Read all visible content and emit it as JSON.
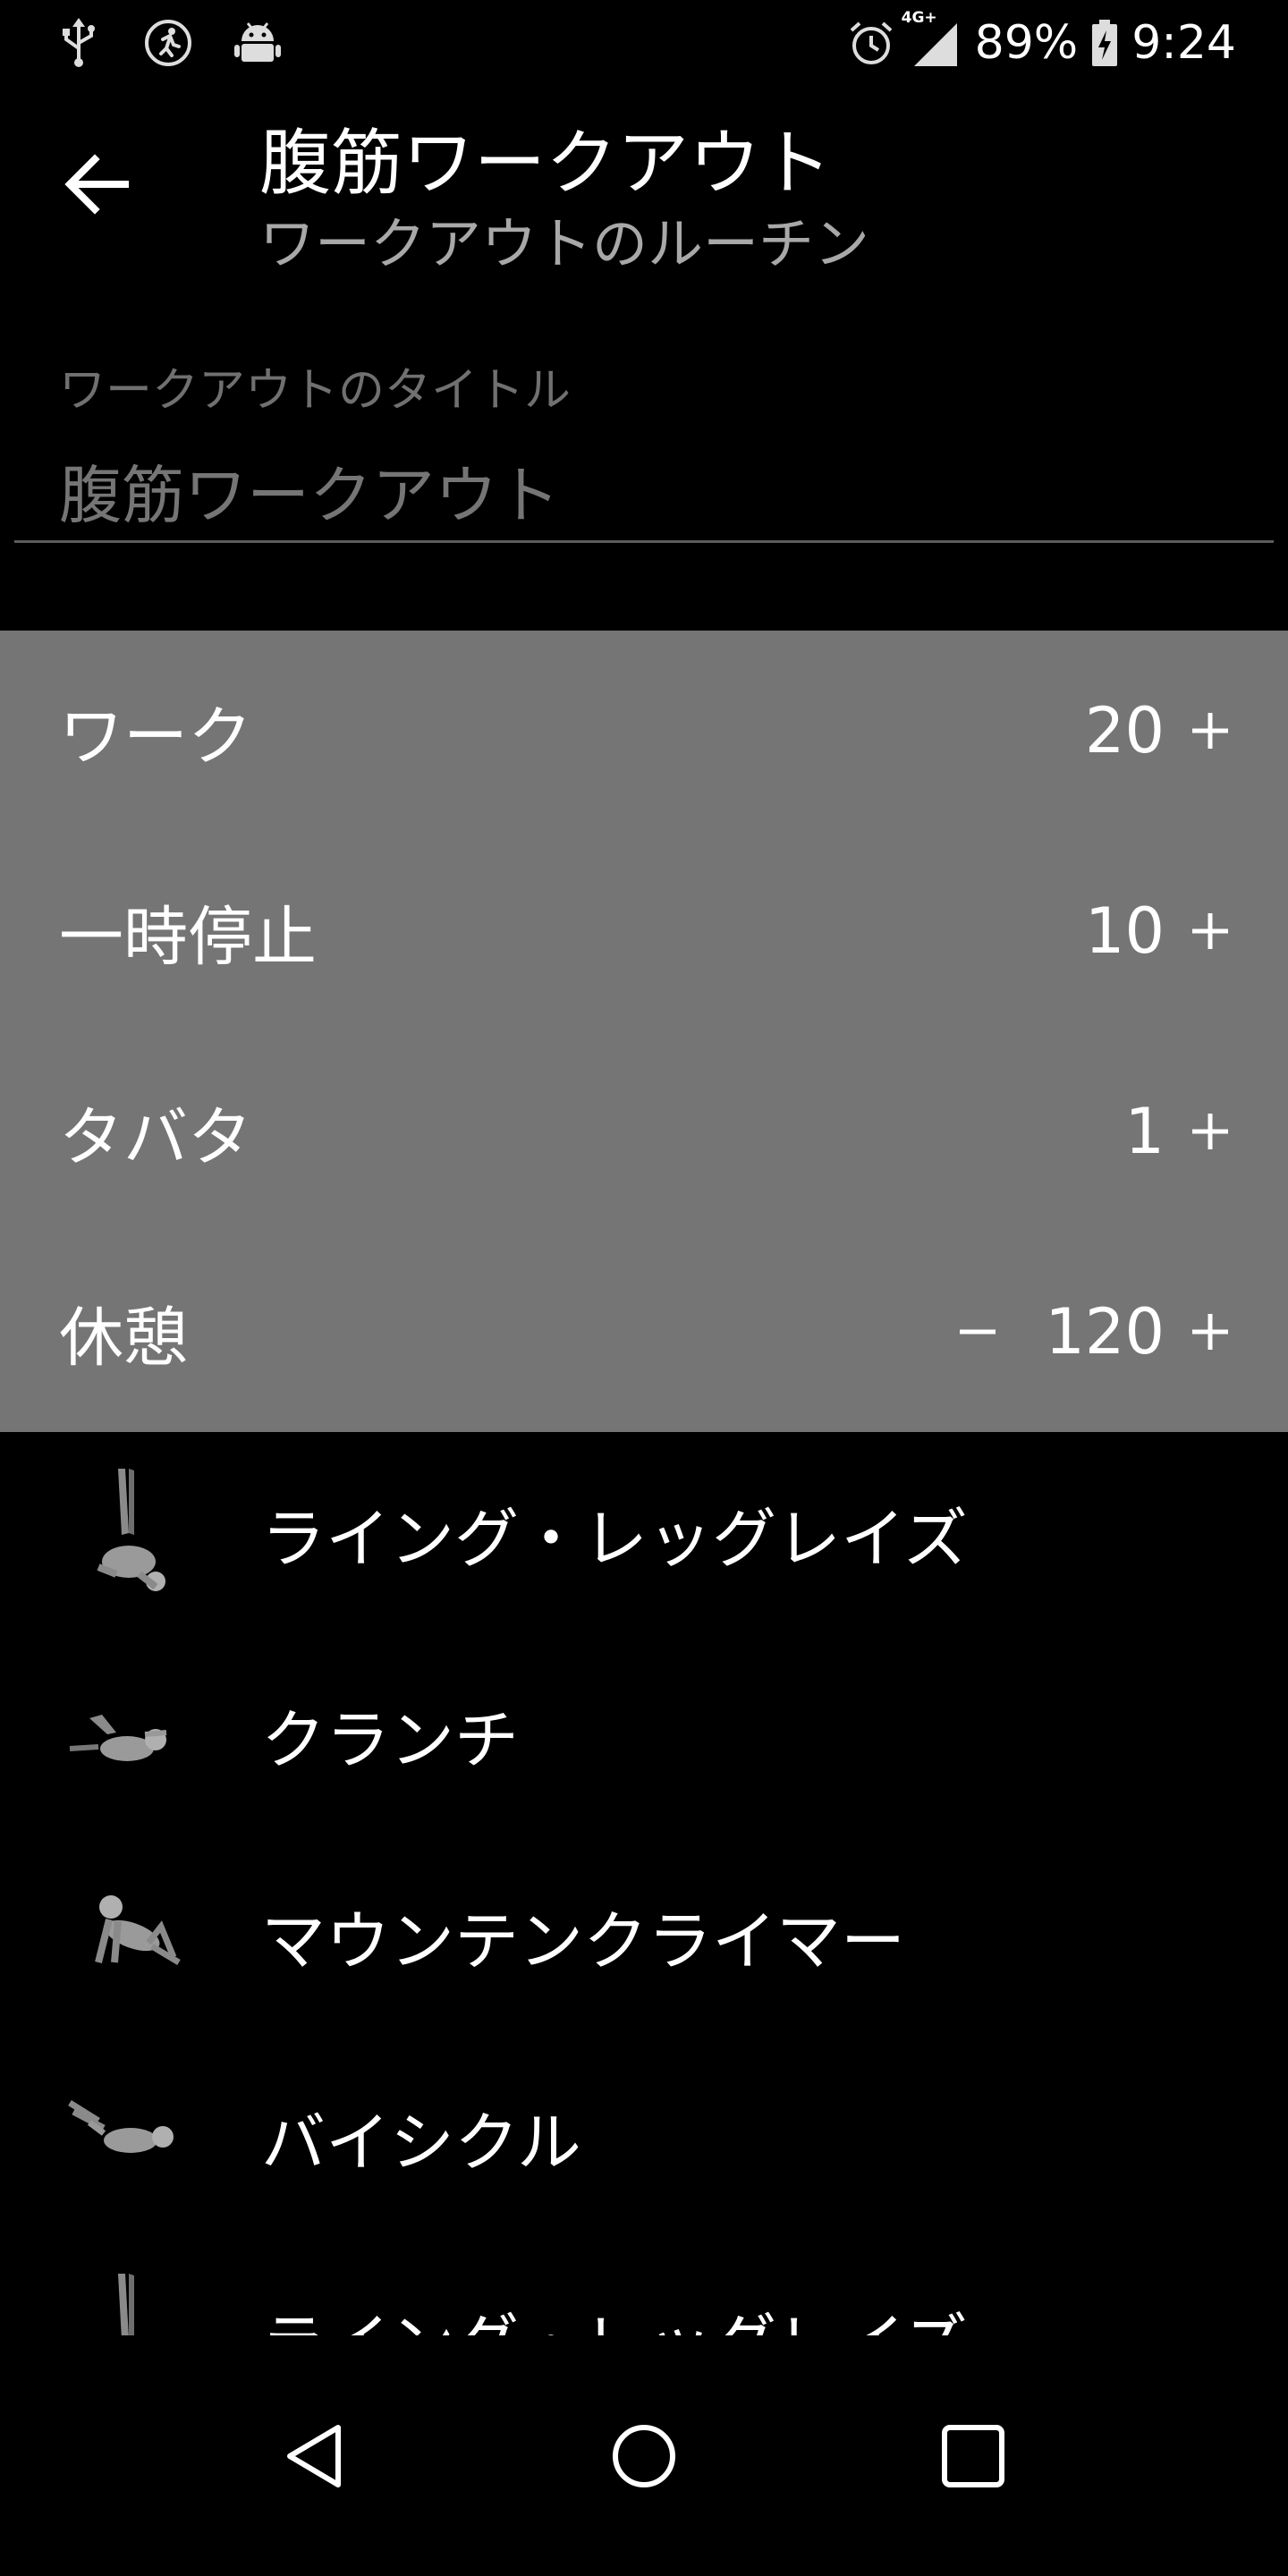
{
  "status_bar": {
    "left_icons": [
      "usb-icon",
      "running-icon",
      "android-icon"
    ],
    "right_icons": [
      "alarm-icon",
      "signal-4g-icon",
      "battery-charging-icon"
    ],
    "network": "4G+",
    "battery": "89%",
    "time": "9:24"
  },
  "app_bar": {
    "back_icon": "arrow-left-icon",
    "title": "腹筋ワークアウト",
    "subtitle": "ワークアウトのルーチン"
  },
  "title_field": {
    "label": "ワークアウトのタイトル",
    "value": "腹筋ワークアウト"
  },
  "settings": [
    {
      "label": "ワーク",
      "value": "20",
      "minus": "",
      "plus": "+"
    },
    {
      "label": "一時停止",
      "value": "10",
      "minus": "",
      "plus": "+"
    },
    {
      "label": "タバタ",
      "value": "1",
      "minus": "",
      "plus": "+"
    },
    {
      "label": "休憩",
      "value": "120",
      "minus": "−",
      "plus": "+"
    }
  ],
  "exercises": [
    {
      "name": "ライング・レッグレイズ",
      "icon": "leg-raise-figure"
    },
    {
      "name": "クランチ",
      "icon": "crunch-figure"
    },
    {
      "name": "マウンテンクライマー",
      "icon": "mountain-climber-figure"
    },
    {
      "name": "バイシクル",
      "icon": "bicycle-figure"
    },
    {
      "name": "ライング・レッグレイズ",
      "icon": "leg-raise-figure"
    }
  ],
  "nav_bar": {
    "icons": [
      "back-triangle-icon",
      "home-circle-icon",
      "recents-square-icon"
    ]
  },
  "colors": {
    "background": "#000000",
    "panel": "#757575",
    "subtitle": "#a8a8a8",
    "hint": "#6e6e6e"
  }
}
